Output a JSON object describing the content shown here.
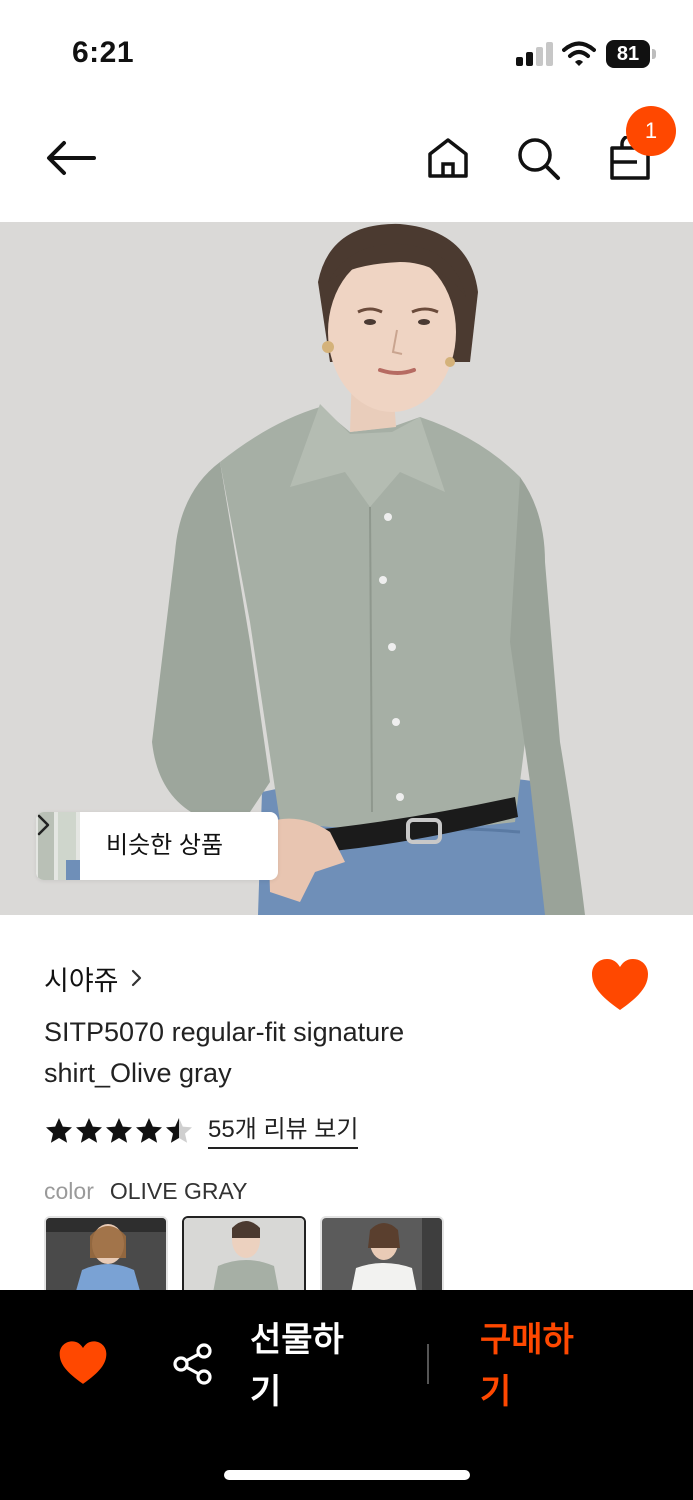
{
  "status_bar": {
    "time": "6:21",
    "battery_level": "81",
    "signal_bars_active": 2,
    "signal_bars_total": 4
  },
  "nav": {
    "icons": [
      "back-arrow-icon",
      "home-icon",
      "search-icon",
      "shopping-bag-icon"
    ],
    "cart_count": "1"
  },
  "hero": {
    "similar_products_label": "비슷한 상품"
  },
  "product": {
    "brand": "시야쥬",
    "title": "SITP5070 regular-fit signature shirt_Olive gray",
    "rating": 4.5,
    "rating_max": 5,
    "review_link": "55개 리뷰 보기",
    "color_label": "color",
    "color_value": "OLIVE GRAY",
    "selected_swatch_index": 1,
    "liked": true
  },
  "bottom_bar": {
    "gift_label": "선물하기",
    "buy_label": "구매하기"
  },
  "colors": {
    "accent": "#ff4800",
    "bottom_bar_bg": "#000000",
    "hero_bg": "#d9d8d6",
    "shirt": "#a4ada3"
  }
}
